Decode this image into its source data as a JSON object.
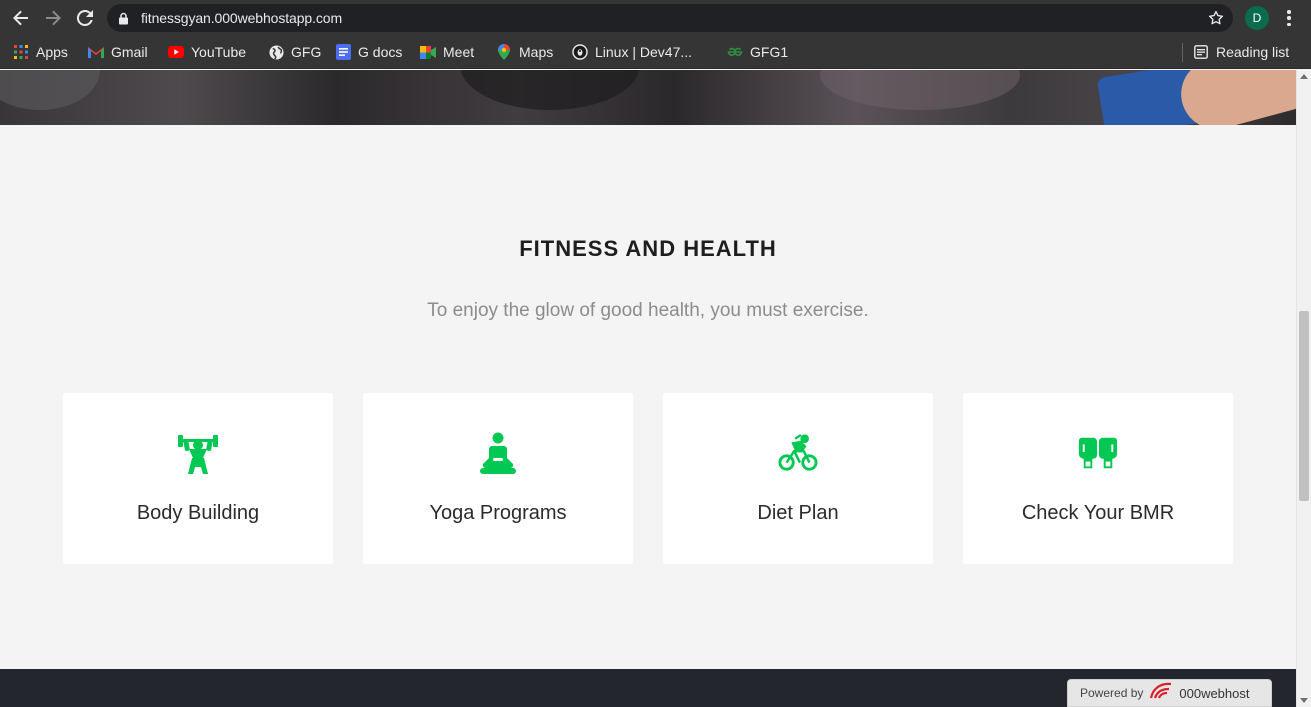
{
  "browser": {
    "url": "fitnessgyan.000webhostapp.com",
    "profile_initial": "D",
    "bookmarks": [
      {
        "label": "Apps",
        "icon": "apps-grid-icon"
      },
      {
        "label": "Gmail",
        "icon": "gmail-icon"
      },
      {
        "label": "YouTube",
        "icon": "youtube-icon"
      },
      {
        "label": "GFG",
        "icon": "globe-icon"
      },
      {
        "label": "G docs",
        "icon": "docs-icon"
      },
      {
        "label": "Meet",
        "icon": "meet-icon"
      },
      {
        "label": "Maps",
        "icon": "maps-icon"
      },
      {
        "label": "Linux | Dev47...",
        "icon": "linux-icon"
      },
      {
        "label": "GFG1",
        "icon": "gfg-icon"
      }
    ],
    "reading_list": "Reading list"
  },
  "section": {
    "title": "FITNESS AND HEALTH",
    "subtitle": "To enjoy the glow of good health, you must exercise."
  },
  "cards": [
    {
      "label": "Body Building",
      "icon": "weightlifter-icon"
    },
    {
      "label": "Yoga Programs",
      "icon": "meditation-icon"
    },
    {
      "label": "Diet Plan",
      "icon": "cyclist-icon"
    },
    {
      "label": "Check Your BMR",
      "icon": "boxing-gloves-icon"
    }
  ],
  "footer": {
    "powered_by": "Powered by",
    "host_brand": "000webhost"
  },
  "colors": {
    "accent_green": "#00c853",
    "page_background": "#f4f4f4",
    "footer_background": "#23262d",
    "chrome_background": "#353535"
  }
}
